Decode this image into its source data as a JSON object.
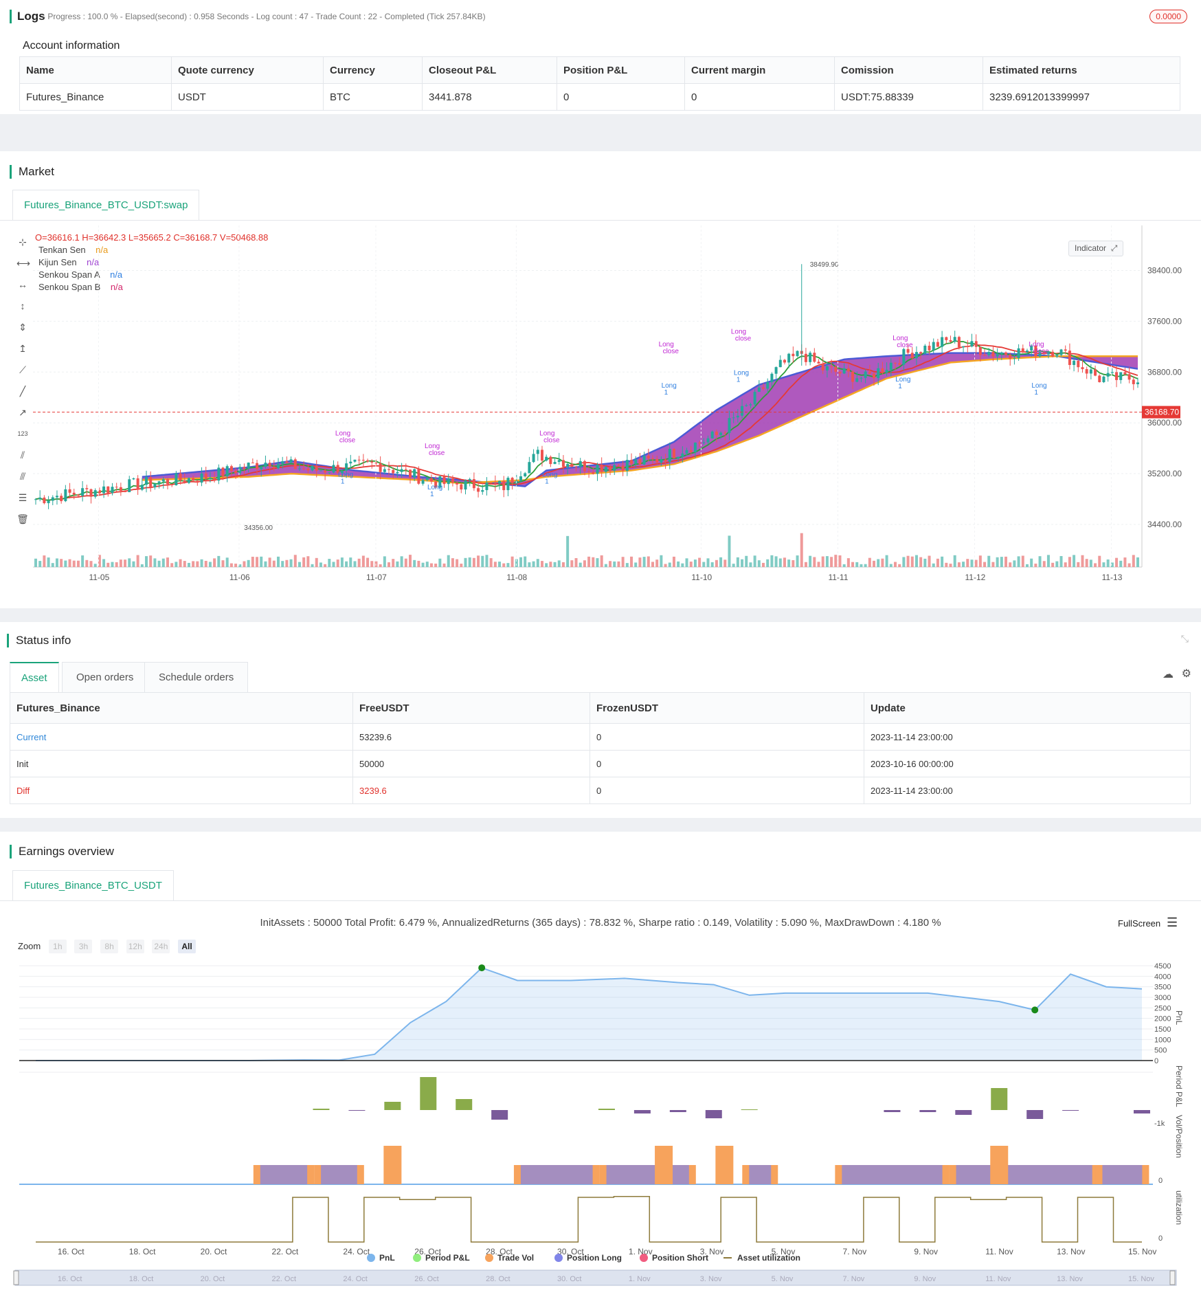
{
  "logs": {
    "title": "Logs",
    "status_line": "- Progress : 100.0 % - Elapsed(second) : 0.958  Seconds - Log count : 47 - Trade Count : 22 - Completed (Tick 257.84KB)",
    "badge": "0.0000"
  },
  "account": {
    "title": "Account information",
    "headers": [
      "Name",
      "Quote currency",
      "Currency",
      "Closeout P&L",
      "Position P&L",
      "Current margin",
      "Comission",
      "Estimated returns"
    ],
    "row": [
      "Futures_Binance",
      "USDT",
      "BTC",
      "3441.878",
      "0",
      "0",
      "USDT:75.88339",
      "3239.6912013399997"
    ]
  },
  "market": {
    "title": "Market",
    "tab": "Futures_Binance_BTC_USDT:swap",
    "ohlc": "O=36616.1 H=36642.3 L=35665.2 C=36168.7 V=50468.88",
    "indicator_btn": "Indicator",
    "legend": [
      {
        "name": "Tenkan Sen",
        "value": "n/a",
        "color": "#e89a1a"
      },
      {
        "name": "Kijun Sen",
        "value": "n/a",
        "color": "#9c3fd0"
      },
      {
        "name": "Senkou Span A",
        "value": "n/a",
        "color": "#2f7fe0"
      },
      {
        "name": "Senkou Span B",
        "value": "n/a",
        "color": "#d3266b"
      }
    ],
    "price_ticks": [
      "38400.00",
      "37600.00",
      "36800.00",
      "36000.00",
      "35200.00",
      "34400.00"
    ],
    "last_price": "36168.70",
    "high_label": "38499.90",
    "low_label": "34356.00",
    "date_ticks": [
      "11-05",
      "11-06",
      "11-07",
      "11-08",
      "11-10",
      "11-11",
      "11-12",
      "11-13"
    ],
    "signals": [
      "Long",
      "close",
      "Long",
      "1"
    ]
  },
  "status": {
    "title": "Status info",
    "tabs": [
      "Asset",
      "Open orders",
      "Schedule orders"
    ],
    "headers": [
      "Futures_Binance",
      "FreeUSDT",
      "FrozenUSDT",
      "Update"
    ],
    "rows": [
      {
        "label": "Current",
        "free": "53239.6",
        "frozen": "0",
        "update": "2023-11-14 23:00:00",
        "color": "#2f87d8"
      },
      {
        "label": "Init",
        "free": "50000",
        "frozen": "0",
        "update": "2023-10-16 00:00:00",
        "color": "#333333"
      },
      {
        "label": "Diff",
        "free": "3239.6",
        "frozen": "0",
        "update": "2023-11-14 23:00:00",
        "color": "#e0302a"
      }
    ]
  },
  "earnings": {
    "title": "Earnings overview",
    "tab": "Futures_Binance_BTC_USDT",
    "summary": "InitAssets : 50000 Total Profit: 6.479 %, AnnualizedReturns (365 days) : 78.832 %, Sharpe ratio : 0.149, Volatility : 5.090 %, MaxDrawDown : 4.180 %",
    "fullscreen": "FullScreen",
    "zoom_label": "Zoom",
    "zoom_buttons": [
      "1h",
      "3h",
      "8h",
      "12h",
      "24h",
      "All"
    ],
    "pnl_ticks": [
      "4500",
      "4000",
      "3500",
      "3000",
      "2500",
      "2000",
      "1500",
      "1000",
      "500",
      "0"
    ],
    "period_tick": "-1k",
    "vol_tick": "0",
    "util_tick": "0",
    "axis_labels": [
      "PnL",
      "Period P&L",
      "Vol/Position",
      "utilization"
    ],
    "date_ticks": [
      "16. Oct",
      "18. Oct",
      "20. Oct",
      "22. Oct",
      "24. Oct",
      "26. Oct",
      "28. Oct",
      "30. Oct",
      "1. Nov",
      "3. Nov",
      "5. Nov",
      "7. Nov",
      "9. Nov",
      "11. Nov",
      "13. Nov",
      "15. Nov"
    ],
    "legend": [
      {
        "name": "PnL",
        "color": "#7cb5ec"
      },
      {
        "name": "Period P&L",
        "color": "#90ed7d"
      },
      {
        "name": "Trade Vol",
        "color": "#f7a35c"
      },
      {
        "name": "Position Long",
        "color": "#8085e9"
      },
      {
        "name": "Position Short",
        "color": "#f15c80"
      },
      {
        "name": "Asset utilization",
        "color": "#8d7a3a"
      }
    ]
  }
}
